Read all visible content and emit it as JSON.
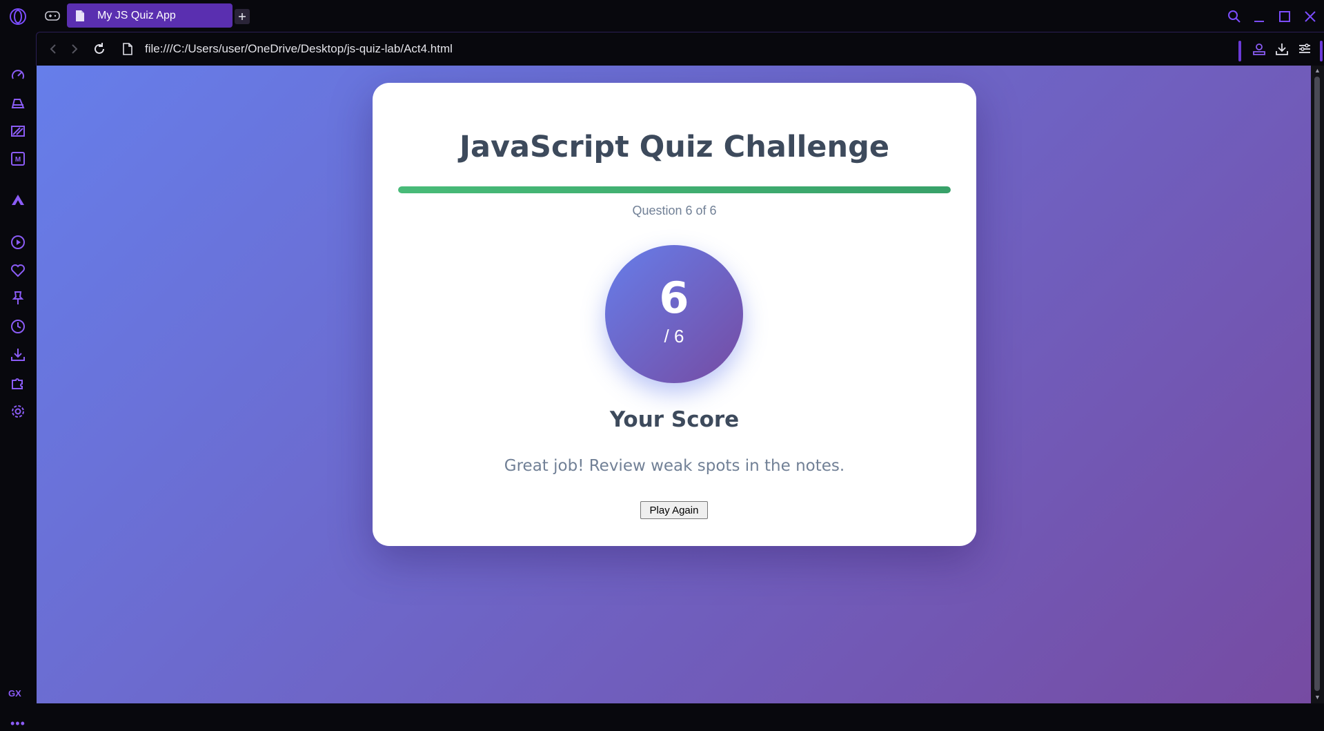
{
  "browser": {
    "tab_title": "My JS Quiz App",
    "url": "file:///C:/Users/user/OneDrive/Desktop/js-quiz-lab/Act4.html",
    "accent_color": "#6b3ad6",
    "sidebar_icons": [
      "speed-dial-icon",
      "gaming-icon",
      "twitch-icon",
      "messenger-icon",
      "aria-icon",
      "player-icon",
      "heart-icon",
      "pin-icon",
      "history-icon",
      "downloads-icon",
      "extensions-icon",
      "settings-icon"
    ],
    "sidebar_gx": "GX",
    "sidebar_more": "•••"
  },
  "quiz": {
    "title": "JavaScript Quiz Challenge",
    "progress_fraction": 1.0,
    "question_counter": "Question 6 of 6",
    "score_value": "6",
    "score_total": "/ 6",
    "score_heading": "Your Score",
    "message": "Great job! Review weak spots in the notes.",
    "play_again_label": "Play Again",
    "progress_color": "#48bb78",
    "gradient_start": "#667eea",
    "gradient_end": "#764ba2"
  }
}
